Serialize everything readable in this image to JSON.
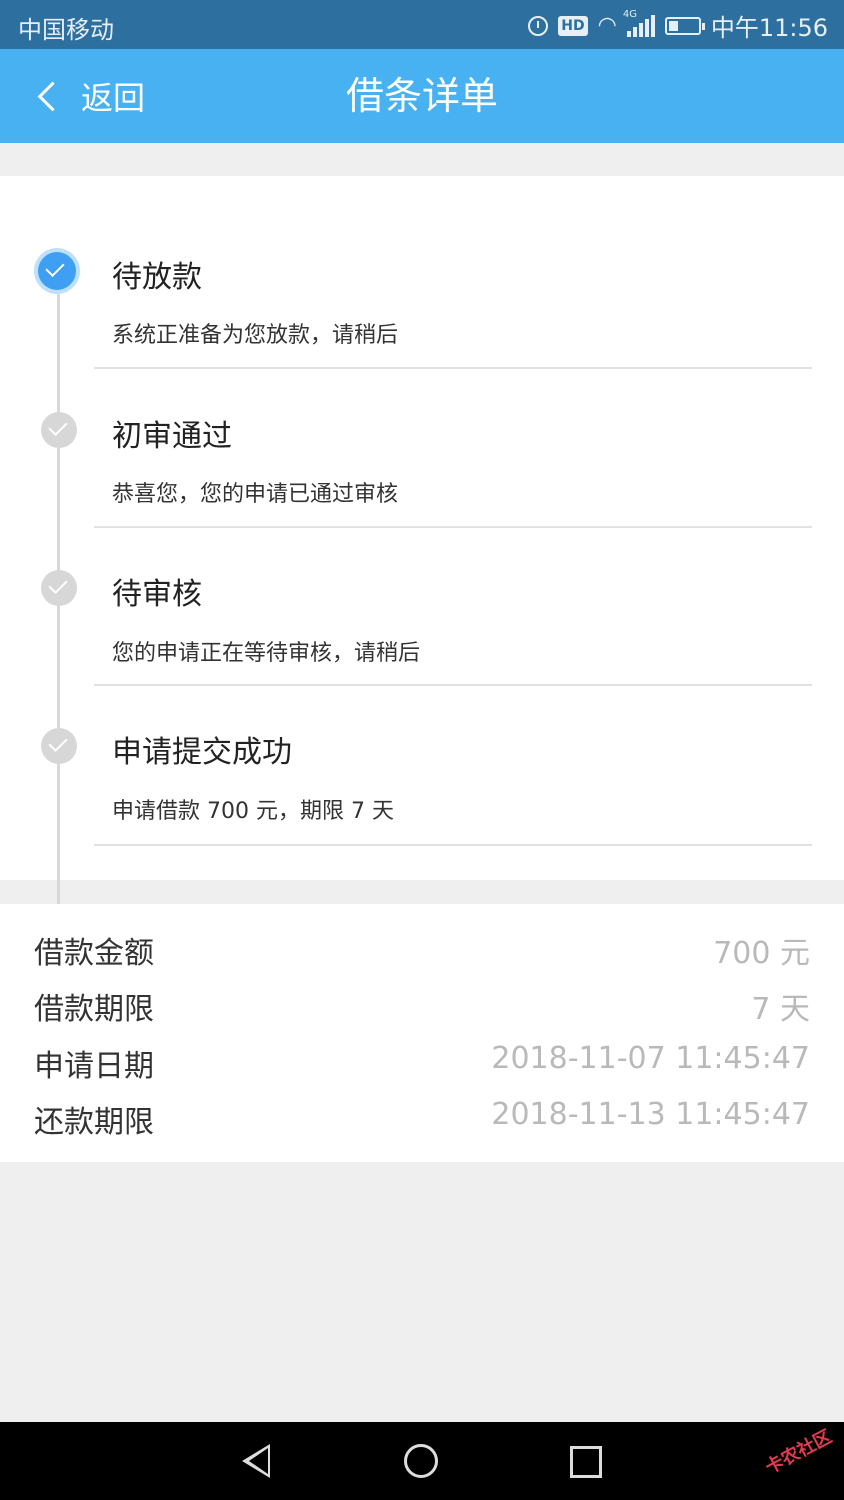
{
  "status_bar": {
    "carrier": "中国移动",
    "network": "4G",
    "time": "中午11:56"
  },
  "nav": {
    "back_label": "返回",
    "title": "借条详单"
  },
  "timeline": [
    {
      "title": "待放款",
      "desc": "系统正准备为您放款，请稍后",
      "active": true
    },
    {
      "title": "初审通过",
      "desc": "恭喜您，您的申请已通过审核",
      "active": false
    },
    {
      "title": "待审核",
      "desc": "您的申请正在等待审核，请稍后",
      "active": false
    },
    {
      "title": "申请提交成功",
      "desc": "申请借款 700 元，期限 7 天",
      "active": false
    }
  ],
  "details": [
    {
      "label": "借款金额",
      "value": "700 元"
    },
    {
      "label": "借款期限",
      "value": "7 天"
    },
    {
      "label": "申请日期",
      "value": "2018-11-07 11:45:47"
    },
    {
      "label": "还款期限",
      "value": "2018-11-13 11:45:47"
    }
  ],
  "colors": {
    "status_bar": "#2d6f9f",
    "nav_bar": "#48b1f1",
    "active_dot": "#3f9ff2",
    "inactive_dot": "#d7d7d7",
    "value_text": "#b9b9b9"
  },
  "icons": [
    "alarm-icon",
    "hd-icon",
    "wifi-icon",
    "signal-icon",
    "battery-icon",
    "back-chevron-icon",
    "check-icon",
    "nav-back-icon",
    "nav-home-icon",
    "nav-recents-icon"
  ],
  "watermark": "卡农社区"
}
